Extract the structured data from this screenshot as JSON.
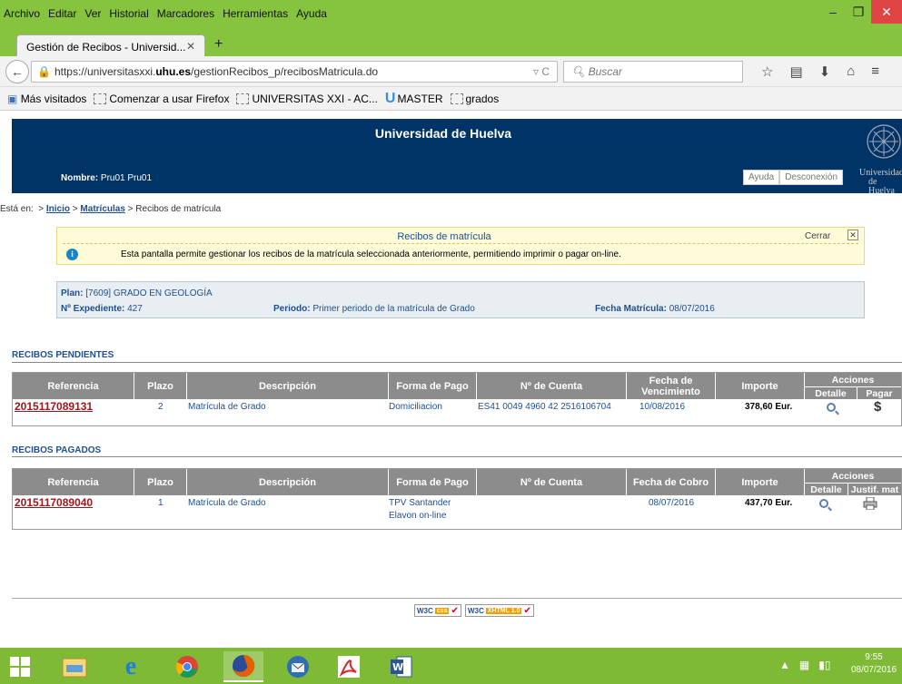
{
  "browser": {
    "menu": [
      "Archivo",
      "Editar",
      "Ver",
      "Historial",
      "Marcadores",
      "Herramientas",
      "Ayuda"
    ],
    "tab_title": "Gestión de Recibos - Universid...",
    "url_prefix": "https://universitasxxi.",
    "url_domain": "uhu.es",
    "url_path": "/gestionRecibos_p/recibosMatricula.do",
    "search_placeholder": "Buscar",
    "bookmarks": [
      "Más visitados",
      "Comenzar a usar Firefox",
      "UNIVERSITAS XXI - AC...",
      "MASTER",
      "grados"
    ]
  },
  "header": {
    "title": "Universidad de Huelva",
    "user_label": "Nombre:",
    "user_value": "Pru01 Pru01",
    "help": "Ayuda",
    "logout": "Desconexión",
    "logo_text_1": "Universidad",
    "logo_text_2": "de Huelva"
  },
  "breadcrumb": {
    "prefix": "Está en:",
    "sep": ">",
    "items": [
      "Inicio",
      "Matrículas",
      "Recibos de matrícula"
    ]
  },
  "info": {
    "title": "Recibos de matrícula",
    "close": "Cerrar",
    "message": "Esta pantalla permite gestionar los recibos de la matrícula seleccionada anteriormente, permitiendo imprimir o pagar on-line."
  },
  "plan": {
    "plan_label": "Plan:",
    "plan_value": "[7609]  GRADO EN GEOLOGÍA",
    "exp_label": "Nº Expediente:",
    "exp_value": "427",
    "periodo_label": "Periodo:",
    "periodo_value": "Primer periodo de la matrícula de Grado",
    "fecha_label": "Fecha Matrícula:",
    "fecha_value": "08/07/2016"
  },
  "pendientes": {
    "title": "RECIBOS PENDIENTES",
    "headers": [
      "Referencia",
      "Plazo",
      "Descripción",
      "Forma de Pago",
      "Nº de Cuenta",
      "Fecha de Vencimiento",
      "Importe",
      "Acciones",
      "Detalle",
      "Pagar"
    ],
    "row": [
      "2015117089131",
      "2",
      "Matrícula de Grado",
      "Domiciliacion",
      "ES41 0049 4960 42 2516106704",
      "10/08/2016",
      "378,60 Eur."
    ]
  },
  "pagados": {
    "title": "RECIBOS PAGADOS",
    "headers": [
      "Referencia",
      "Plazo",
      "Descripción",
      "Forma de Pago",
      "Nº de Cuenta",
      "Fecha de Cobro",
      "Importe",
      "Acciones",
      "Detalle",
      "Justif. mat"
    ],
    "row": [
      "2015117089040",
      "1",
      "Matrícula de Grado",
      "TPV Santander",
      "Elavon on-line",
      "08/07/2016",
      "437,70 Eur."
    ]
  },
  "footer": {
    "w3c1": "W3C",
    "w3c1_badge": "css",
    "w3c2": "W3C",
    "w3c2_badge": "XHTML 1.0"
  },
  "taskbar": {
    "time": "9:55",
    "date": "08/07/2016"
  }
}
